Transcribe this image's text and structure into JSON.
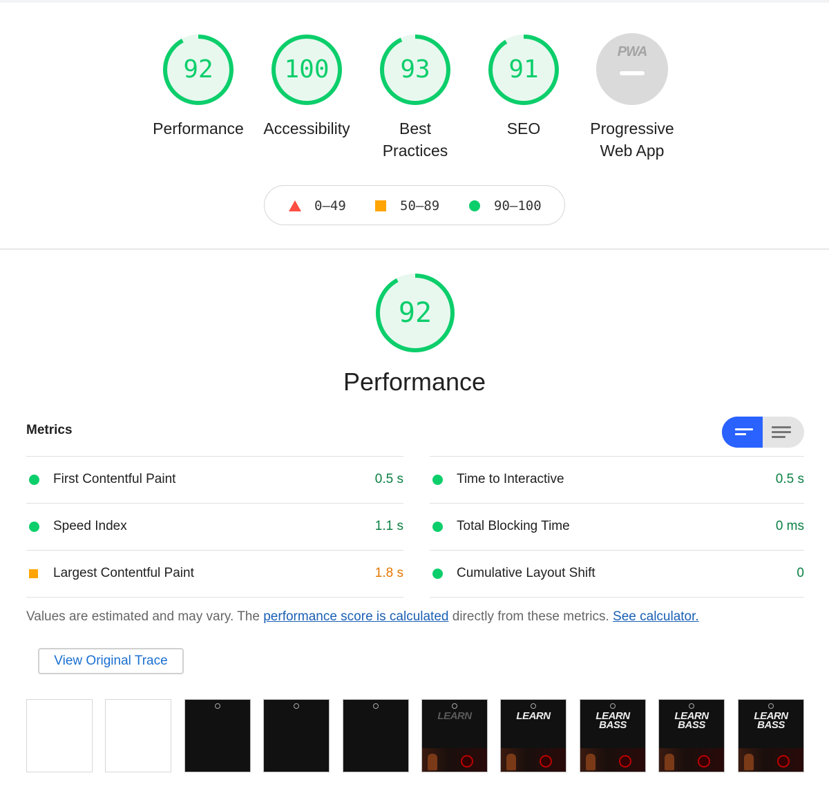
{
  "scores": [
    {
      "label": "Performance",
      "score": "92",
      "fraction": 0.92
    },
    {
      "label": "Accessibility",
      "score": "100",
      "fraction": 1.0
    },
    {
      "label": "Best Practices",
      "score": "93",
      "fraction": 0.93
    },
    {
      "label": "SEO",
      "score": "91",
      "fraction": 0.91
    },
    {
      "label": "Progressive Web App",
      "badge_text": "PWA",
      "score": null
    }
  ],
  "legend": [
    {
      "range": "0–49",
      "shape": "triangle",
      "color": "#ff4e42"
    },
    {
      "range": "50–89",
      "shape": "square",
      "color": "#ffa400"
    },
    {
      "range": "90–100",
      "shape": "circle",
      "color": "#0cce6b"
    }
  ],
  "performance": {
    "score": "92",
    "fraction": 0.92,
    "title": "Performance",
    "metrics_title": "Metrics",
    "metrics_left": [
      {
        "label": "First Contentful Paint",
        "value": "0.5 s",
        "status": "pass"
      },
      {
        "label": "Speed Index",
        "value": "1.1 s",
        "status": "pass"
      },
      {
        "label": "Largest Contentful Paint",
        "value": "1.8 s",
        "status": "average"
      }
    ],
    "metrics_right": [
      {
        "label": "Time to Interactive",
        "value": "0.5 s",
        "status": "pass"
      },
      {
        "label": "Total Blocking Time",
        "value": "0 ms",
        "status": "pass"
      },
      {
        "label": "Cumulative Layout Shift",
        "value": "0",
        "status": "pass"
      }
    ],
    "note": {
      "prefix": "Values are estimated and may vary. The ",
      "link1": "performance score is calculated",
      "middle": " directly from these metrics. ",
      "link2": "See calculator."
    },
    "trace_button": "View Original Trace",
    "filmstrip": [
      {
        "kind": "blank"
      },
      {
        "kind": "blank"
      },
      {
        "kind": "dark"
      },
      {
        "kind": "dark"
      },
      {
        "kind": "dark"
      },
      {
        "kind": "text",
        "text": "LEARN",
        "dim": true
      },
      {
        "kind": "text",
        "text": "LEARN",
        "dim": false
      },
      {
        "kind": "text2",
        "text": "LEARN",
        "text2": "BASS"
      },
      {
        "kind": "text2",
        "text": "LEARN",
        "text2": "BASS"
      },
      {
        "kind": "text2",
        "text": "LEARN",
        "text2": "BASS"
      }
    ]
  },
  "colors": {
    "pass": "#0cce6b",
    "average": "#ffa400",
    "fail": "#ff4e42",
    "pass_bg": "#e8f8ef",
    "accent": "#2962ff"
  }
}
